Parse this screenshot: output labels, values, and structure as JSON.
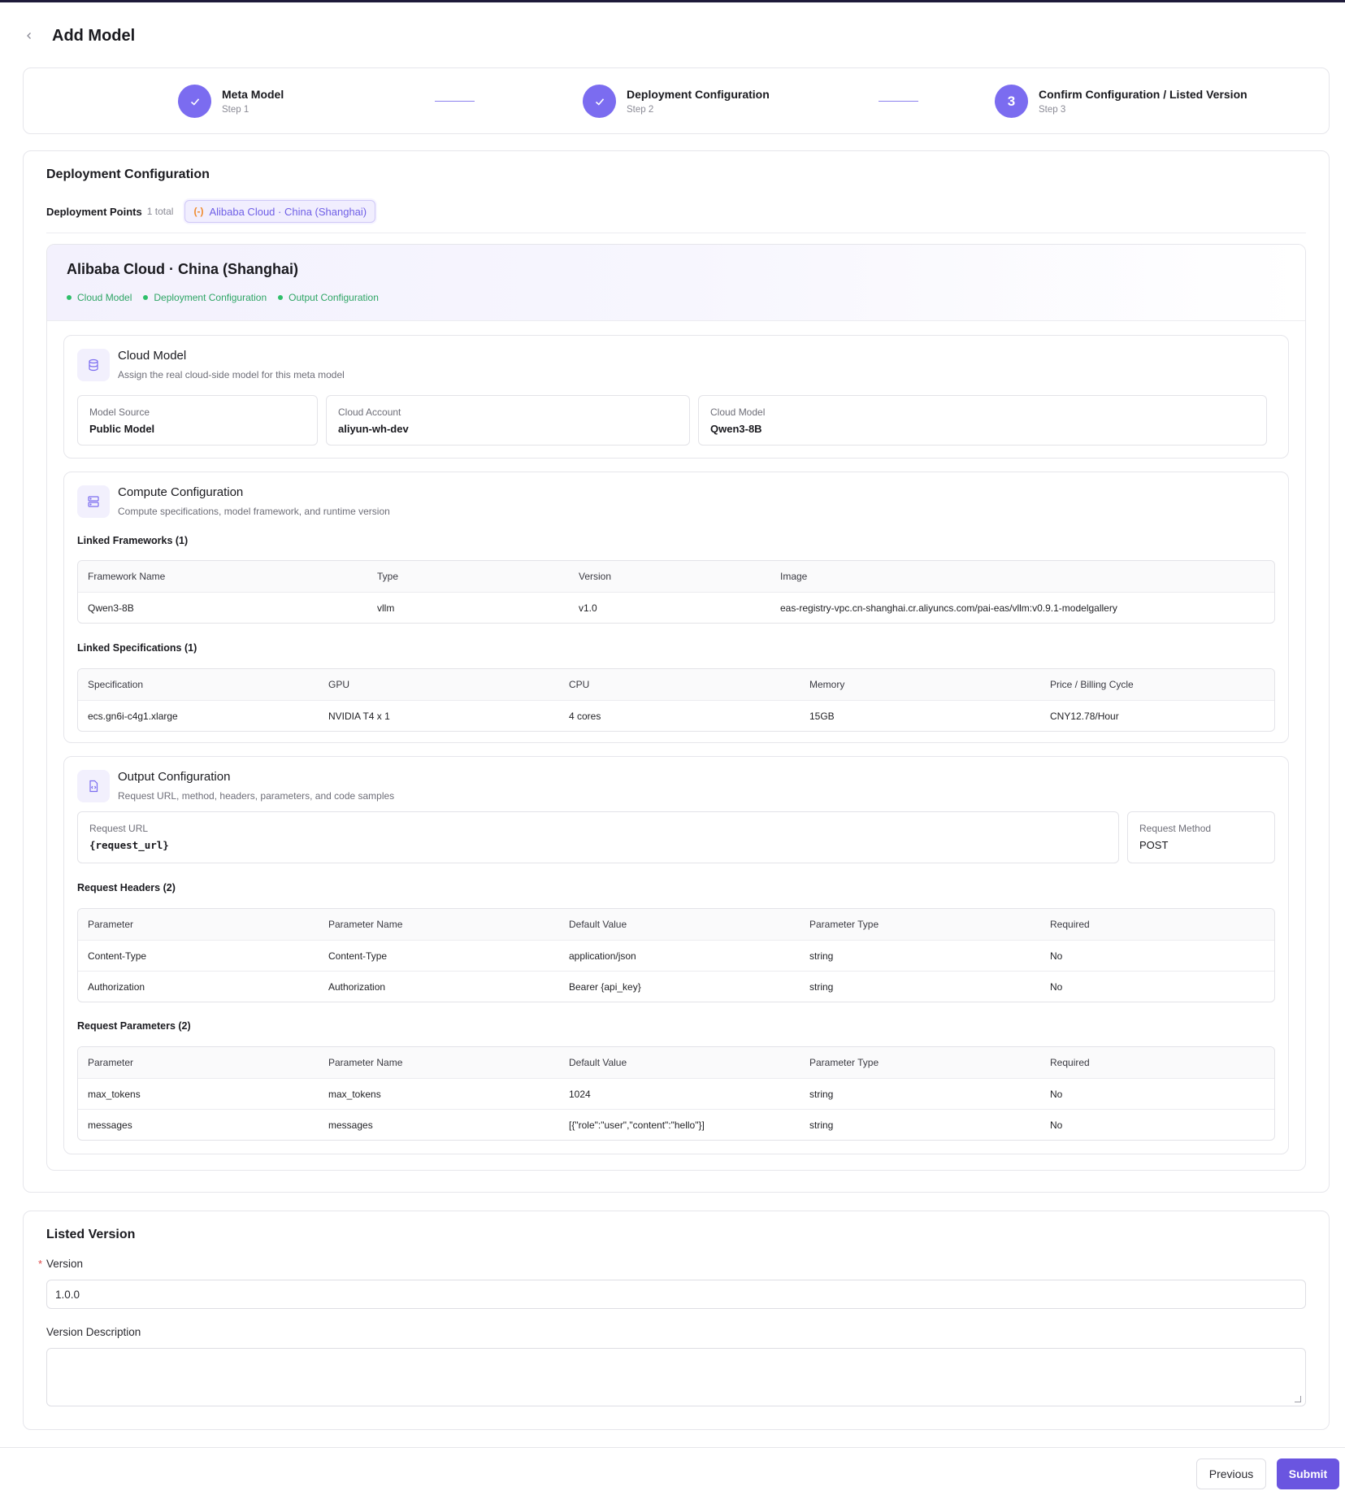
{
  "page": {
    "title": "Add Model"
  },
  "steps": [
    {
      "title": "Meta Model",
      "sub": "Step 1",
      "state": "done"
    },
    {
      "title": "Deployment Configuration",
      "sub": "Step 2",
      "state": "done"
    },
    {
      "title": "Confirm Configuration / Listed Version",
      "sub": "Step 3",
      "number": "3",
      "state": "active"
    }
  ],
  "deployment": {
    "title": "Deployment Configuration",
    "points_label": "Deployment Points",
    "points_count": "1 total",
    "point_chip": "Alibaba Cloud · China (Shanghai)",
    "region": {
      "title": "Alibaba Cloud · China (Shanghai)",
      "tags": [
        "Cloud Model",
        "Deployment Configuration",
        "Output Configuration"
      ]
    }
  },
  "cloud_model": {
    "title": "Cloud Model",
    "subtitle": "Assign the real cloud-side model for this meta model",
    "fields": [
      {
        "label": "Model Source",
        "value": "Public Model"
      },
      {
        "label": "Cloud Account",
        "value": "aliyun-wh-dev"
      },
      {
        "label": "Cloud Model",
        "value": "Qwen3-8B"
      }
    ]
  },
  "compute": {
    "title": "Compute Configuration",
    "subtitle": "Compute specifications, model framework, and runtime version",
    "frameworks_label": "Linked Frameworks (1)",
    "frameworks_headers": [
      "Framework Name",
      "Type",
      "Version",
      "Image"
    ],
    "frameworks_rows": [
      [
        "Qwen3-8B",
        "vllm",
        "v1.0",
        "eas-registry-vpc.cn-shanghai.cr.aliyuncs.com/pai-eas/vllm:v0.9.1-modelgallery"
      ]
    ],
    "specs_label": "Linked Specifications (1)",
    "specs_headers": [
      "Specification",
      "GPU",
      "CPU",
      "Memory",
      "Price / Billing Cycle"
    ],
    "specs_rows": [
      [
        "ecs.gn6i-c4g1.xlarge",
        "NVIDIA T4 x 1",
        "4 cores",
        "15GB",
        "CNY12.78/Hour"
      ]
    ]
  },
  "output": {
    "title": "Output Configuration",
    "subtitle": "Request URL, method, headers, parameters, and code samples",
    "url_label": "Request URL",
    "url_value": "{request_url}",
    "method_label": "Request Method",
    "method_value": "POST",
    "headers_label": "Request Headers (2)",
    "params_label": "Request Parameters (2)",
    "table_headers": [
      "Parameter",
      "Parameter Name",
      "Default Value",
      "Parameter Type",
      "Required"
    ],
    "headers_rows": [
      [
        "Content-Type",
        "Content-Type",
        "application/json",
        "string",
        "No"
      ],
      [
        "Authorization",
        "Authorization",
        "Bearer {api_key}",
        "string",
        "No"
      ]
    ],
    "params_rows": [
      [
        "max_tokens",
        "max_tokens",
        "1024",
        "string",
        "No"
      ],
      [
        "messages",
        "messages",
        "[{\"role\":\"user\",\"content\":\"hello\"}]",
        "string",
        "No"
      ]
    ]
  },
  "listed_version": {
    "title": "Listed Version",
    "version_label": "Version",
    "required_mark": "*",
    "version_value": "1.0.0",
    "description_label": "Version Description",
    "description_value": ""
  },
  "footer": {
    "previous": "Previous",
    "submit": "Submit"
  },
  "colors": {
    "accent": "#7b6cf0",
    "primary_button": "#6a55e0",
    "success": "#2fbf6a",
    "chip_icon": "#f08a2c"
  }
}
